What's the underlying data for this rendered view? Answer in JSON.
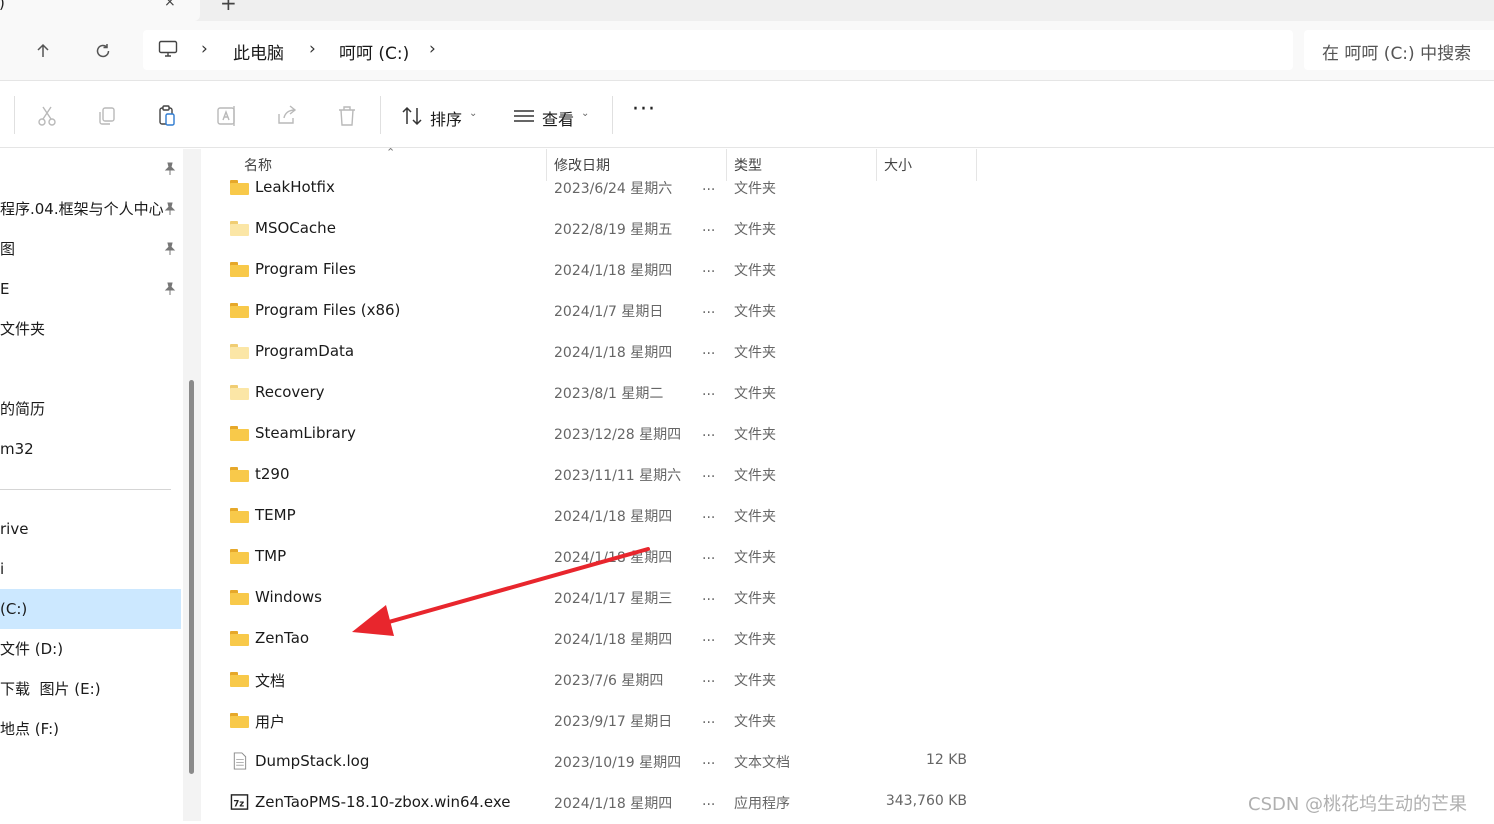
{
  "tab": {
    "title": ")",
    "close": "×",
    "new_tab": "+"
  },
  "address": {
    "crumbs": [
      "此电脑",
      "呵呵 (C:)"
    ],
    "chevron": "›",
    "search_placeholder": "在 呵呵 (C:) 中搜索"
  },
  "toolbar": {
    "sort_label": "排序",
    "view_label": "查看",
    "more": "···",
    "caret": "⌄"
  },
  "sidebar": {
    "items": [
      {
        "label": "程序.04.框架与个人中心",
        "pinned": true
      },
      {
        "label": "图",
        "pinned": true
      },
      {
        "label": "E",
        "pinned": true
      },
      {
        "label": "文件夹",
        "pinned": false
      },
      {
        "label": "的简历",
        "pinned": false
      },
      {
        "label": "m32",
        "pinned": false
      },
      {
        "label": "rive",
        "pinned": false
      },
      {
        "label": "i",
        "pinned": false
      },
      {
        "label": "(C:)",
        "pinned": false,
        "selected": true
      },
      {
        "label": "文件 (D:)",
        "pinned": false
      },
      {
        "label": "下载  图片 (E:)",
        "pinned": false
      },
      {
        "label": "地点 (F:)",
        "pinned": false
      }
    ]
  },
  "columns": {
    "name": "名称",
    "date": "修改日期",
    "type": "类型",
    "size": "大小"
  },
  "files": [
    {
      "name": "LeakHotfix",
      "date": "2023/6/24 星期六",
      "type": "文件夹",
      "size": "",
      "icon": "folder"
    },
    {
      "name": "MSOCache",
      "date": "2022/8/19 星期五",
      "type": "文件夹",
      "size": "",
      "icon": "folder-hidden"
    },
    {
      "name": "Program Files",
      "date": "2024/1/18 星期四",
      "type": "文件夹",
      "size": "",
      "icon": "folder"
    },
    {
      "name": "Program Files (x86)",
      "date": "2024/1/7 星期日",
      "type": "文件夹",
      "size": "",
      "icon": "folder"
    },
    {
      "name": "ProgramData",
      "date": "2024/1/18 星期四",
      "type": "文件夹",
      "size": "",
      "icon": "folder-hidden"
    },
    {
      "name": "Recovery",
      "date": "2023/8/1 星期二",
      "type": "文件夹",
      "size": "",
      "icon": "folder-hidden"
    },
    {
      "name": "SteamLibrary",
      "date": "2023/12/28 星期四",
      "type": "文件夹",
      "size": "",
      "icon": "folder"
    },
    {
      "name": "t290",
      "date": "2023/11/11 星期六",
      "type": "文件夹",
      "size": "",
      "icon": "folder"
    },
    {
      "name": "TEMP",
      "date": "2024/1/18 星期四",
      "type": "文件夹",
      "size": "",
      "icon": "folder"
    },
    {
      "name": "TMP",
      "date": "2024/1/18 星期四",
      "type": "文件夹",
      "size": "",
      "icon": "folder"
    },
    {
      "name": "Windows",
      "date": "2024/1/17 星期三",
      "type": "文件夹",
      "size": "",
      "icon": "folder"
    },
    {
      "name": "ZenTao",
      "date": "2024/1/18 星期四",
      "type": "文件夹",
      "size": "",
      "icon": "folder"
    },
    {
      "name": "文档",
      "date": "2023/7/6 星期四",
      "type": "文件夹",
      "size": "",
      "icon": "folder"
    },
    {
      "name": "用户",
      "date": "2023/9/17 星期日",
      "type": "文件夹",
      "size": "",
      "icon": "folder"
    },
    {
      "name": "DumpStack.log",
      "date": "2023/10/19 星期四",
      "type": "文本文档",
      "size": "12 KB",
      "icon": "text-file"
    },
    {
      "name": "ZenTaoPMS-18.10-zbox.win64.exe",
      "date": "2024/1/18 星期四",
      "type": "应用程序",
      "size": "343,760 KB",
      "icon": "exe-7z"
    }
  ],
  "row_dots": "...",
  "watermark": "CSDN @桃花坞生动的芒果",
  "colors": {
    "selection": "#cce8ff",
    "folder": "#f8c94a",
    "arrow": "#e8262d"
  }
}
